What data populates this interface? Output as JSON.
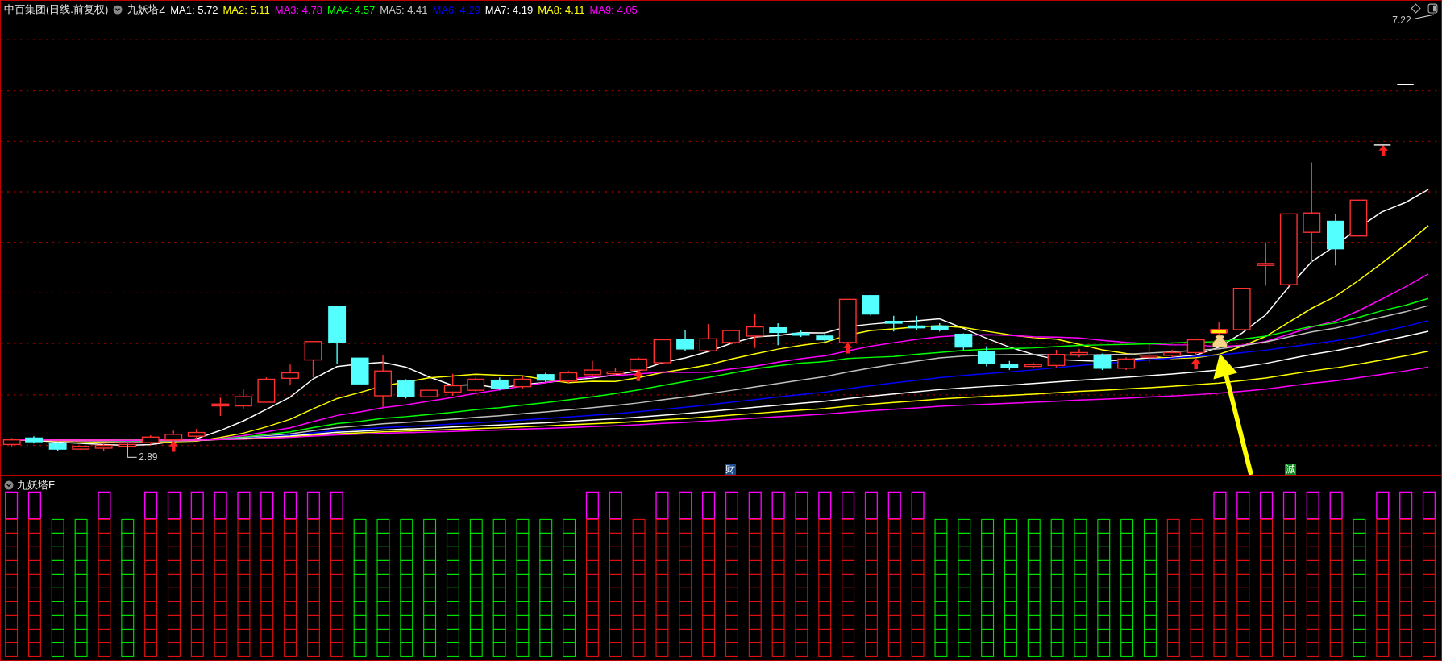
{
  "main_panel": {
    "stock_title": "中百集团(日线.前复权)",
    "indicator_name": "九妖塔Z",
    "legend": [
      {
        "label": "MA1: 5.72",
        "color": "#ffffff"
      },
      {
        "label": "MA2: 5.11",
        "color": "#ffff00"
      },
      {
        "label": "MA3: 4.78",
        "color": "#ff00ff"
      },
      {
        "label": "MA4: 4.57",
        "color": "#00ff00"
      },
      {
        "label": "MA5: 4.41",
        "color": "#c0c0c0"
      },
      {
        "label": "MA6: 4.29",
        "color": "#0000ff"
      },
      {
        "label": "MA7: 4.19",
        "color": "#ffffff"
      },
      {
        "label": "MA8: 4.11",
        "color": "#ffff00"
      },
      {
        "label": "MA9: 4.05",
        "color": "#ff00ff"
      }
    ],
    "high_label": "7.22",
    "low_label": "2.89",
    "signals": [
      {
        "text": "财",
        "color": "#1a4a8a"
      },
      {
        "text": "減",
        "color": "#0a8a1a"
      }
    ]
  },
  "lower_panel": {
    "indicator_name": "九妖塔F"
  }
}
